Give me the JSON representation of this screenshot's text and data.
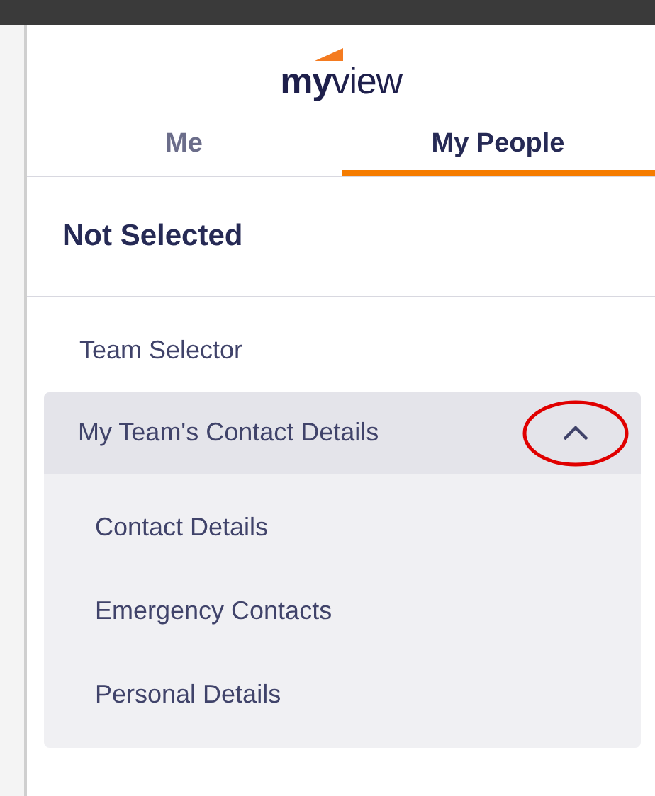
{
  "logo": {
    "text": "**my**view"
  },
  "tabs": [
    {
      "label": "Me",
      "selected": false
    },
    {
      "label": "My People",
      "selected": true
    }
  ],
  "selection": {
    "title": "Not Selected"
  },
  "menu": [
    {
      "label": "Team Selector",
      "kind": "link"
    },
    {
      "label": "My Team's Contact Details",
      "kind": "group",
      "expanded": true,
      "children": [
        {
          "label": "Contact Details"
        },
        {
          "label": "Emergency Contacts"
        },
        {
          "label": "Personal Details"
        }
      ]
    }
  ]
}
